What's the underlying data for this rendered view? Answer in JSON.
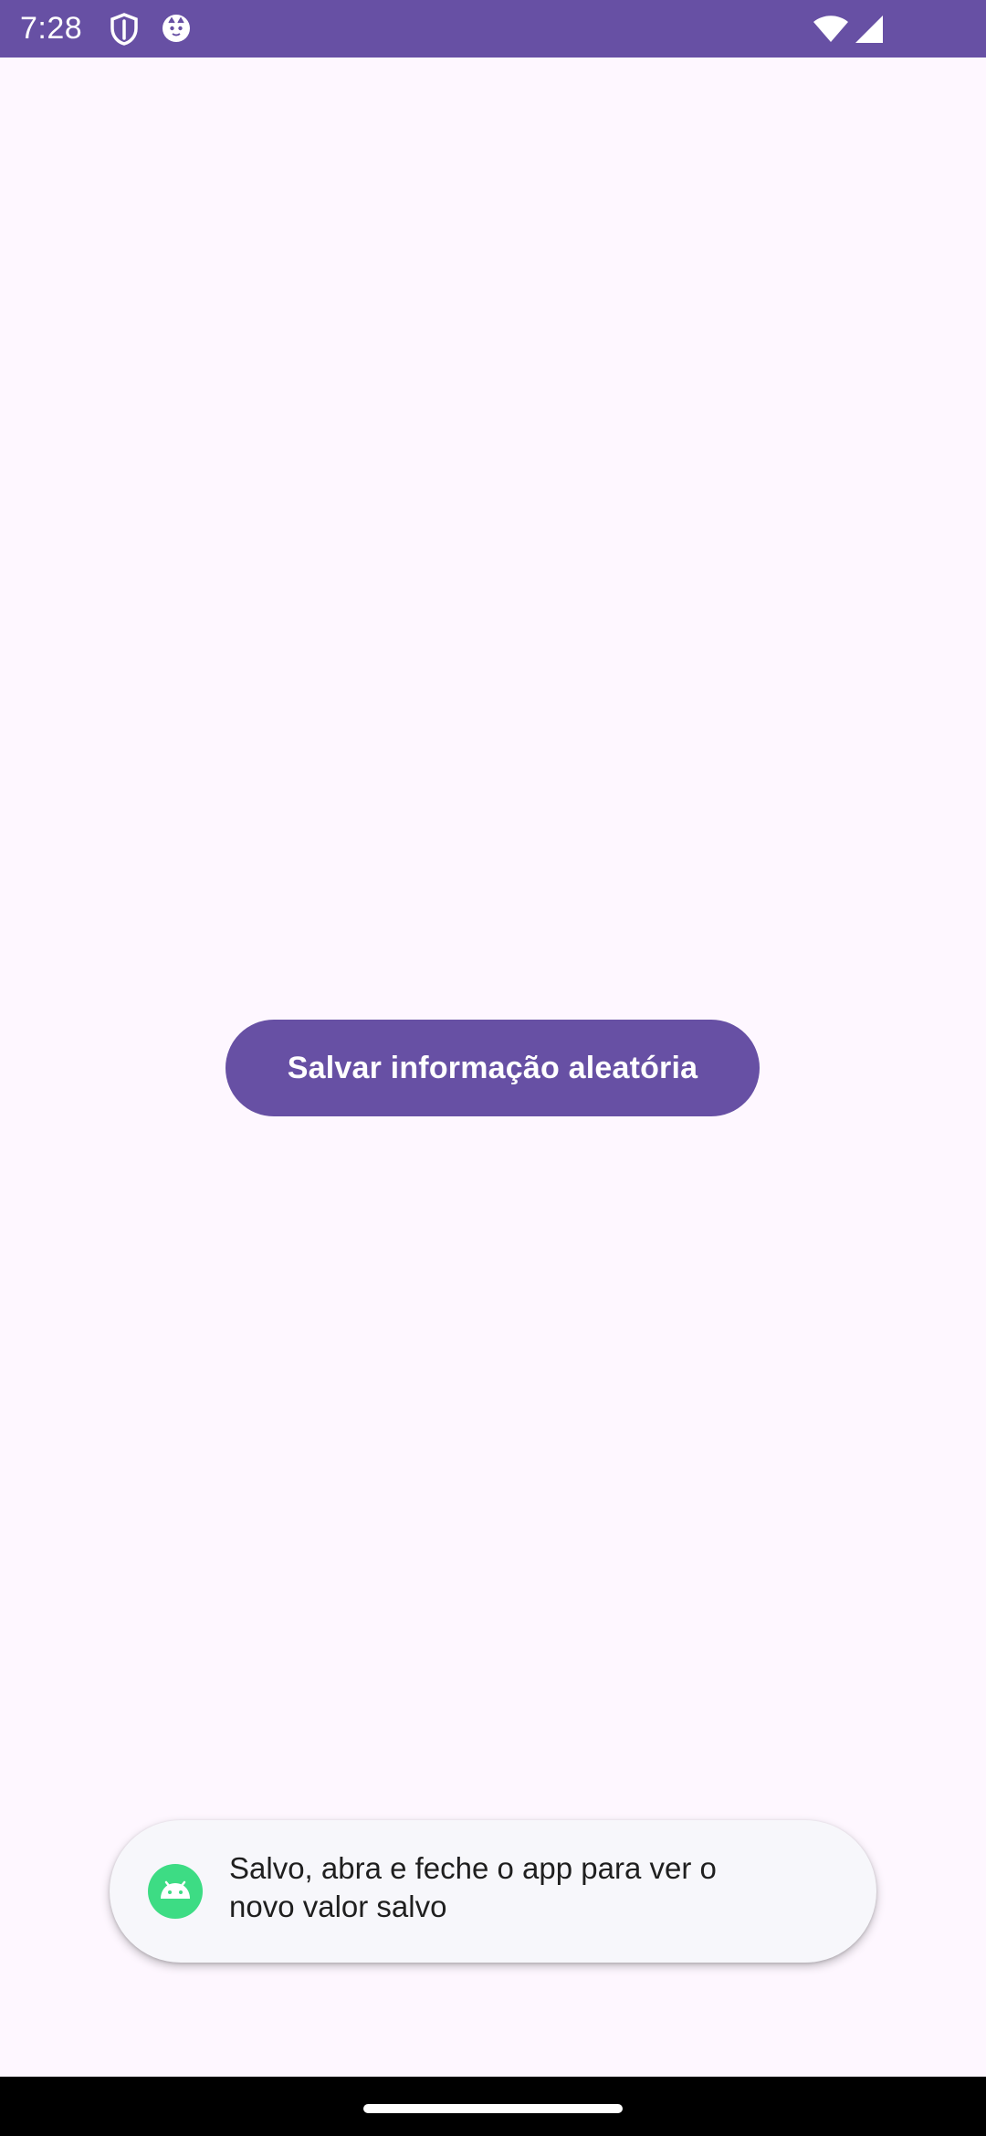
{
  "status_bar": {
    "time": "7:28",
    "background_color": "#6750A4",
    "icons": [
      "shield-icon",
      "cat-face-icon",
      "wifi-icon",
      "cell-signal-icon"
    ]
  },
  "main": {
    "background_color": "#FEF7FF",
    "save_button_label": "Salvar informação aleatória",
    "button_color": "#6750A4"
  },
  "toast": {
    "message": "Salvo, abra e feche o app para ver o\nnovo valor salvo",
    "icon": "android-icon",
    "icon_color": "#3DDC84"
  },
  "nav_bar": {
    "background_color": "#000000",
    "handle": "home-handle"
  }
}
